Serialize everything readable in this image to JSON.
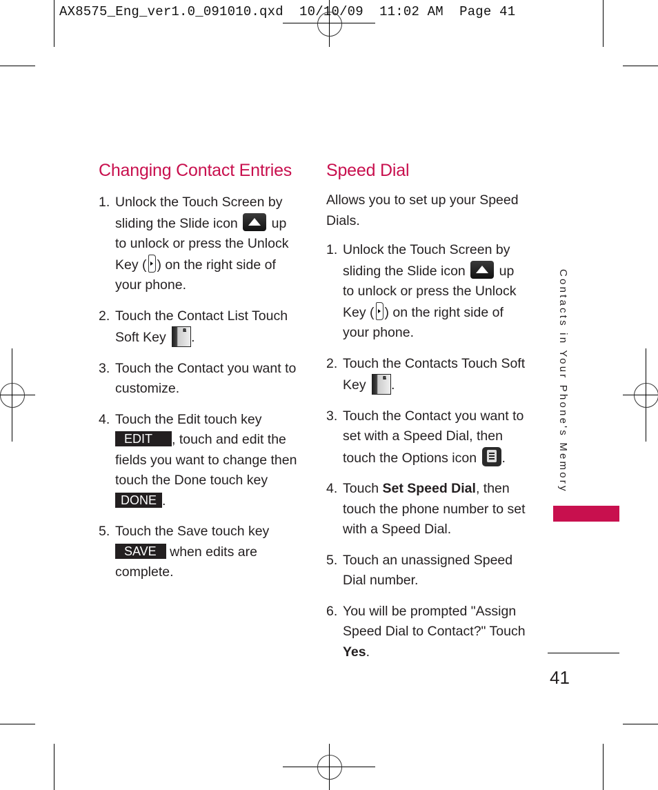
{
  "slug_line": "AX8575_Eng_ver1.0_091010.qxd  10/10/09  11:02 AM  Page 41",
  "left_section": {
    "heading": "Changing Contact Entries",
    "steps": [
      {
        "num": "1.",
        "parts": [
          "Unlock the Touch Screen by sliding the Slide icon",
          "up to unlock or press the Unlock Key (",
          ") on the right side of your phone."
        ]
      },
      {
        "num": "2.",
        "parts": [
          "Touch the Contact List Touch Soft Key",
          "."
        ]
      },
      {
        "num": "3.",
        "parts": [
          "Touch the Contact you want to customize."
        ]
      },
      {
        "num": "4.",
        "parts": [
          "Touch the Edit touch key",
          ",  touch and edit the fields you want to change then touch the Done touch key",
          "."
        ]
      },
      {
        "num": "5.",
        "parts": [
          "Touch the Save touch key",
          "when edits are complete."
        ]
      }
    ],
    "keys": {
      "edit": "EDIT",
      "done": "DONE",
      "save": "SAVE"
    }
  },
  "right_section": {
    "heading": "Speed Dial",
    "intro": "Allows you to set up your Speed Dials.",
    "steps": [
      {
        "num": "1.",
        "parts": [
          "Unlock the Touch Screen by sliding the Slide icon",
          "up to unlock or press the Unlock Key (",
          ") on the right side of your phone."
        ]
      },
      {
        "num": "2.",
        "parts": [
          "Touch the Contacts Touch Soft Key",
          "."
        ]
      },
      {
        "num": "3.",
        "parts": [
          "Touch the Contact you want to set with a Speed Dial, then touch the Options icon",
          "."
        ]
      },
      {
        "num": "4.",
        "parts": [
          "Touch",
          "Set Speed Dial",
          ", then touch the phone number to set with a Speed Dial."
        ]
      },
      {
        "num": "5.",
        "parts": [
          "Touch an unassigned Speed Dial number."
        ]
      },
      {
        "num": "6.",
        "parts": [
          "You will be prompted \"Assign Speed Dial to Contact?\" Touch",
          "Yes",
          "."
        ]
      }
    ]
  },
  "icons": {
    "abc_letters": [
      "A",
      "B",
      "C"
    ]
  },
  "sidebar": {
    "section_title": "Contacts in Your Phone's Memory",
    "accent_color": "#c8104e"
  },
  "page_number": "41"
}
